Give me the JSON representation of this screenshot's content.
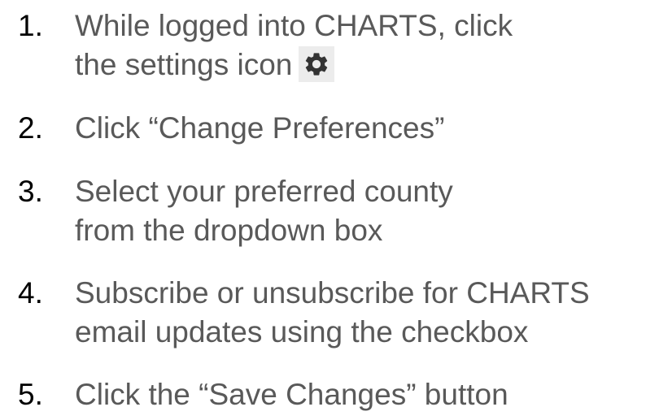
{
  "steps": [
    {
      "number": "1.",
      "lines": [
        "While logged into CHARTS, click",
        "the settings icon"
      ],
      "icon": "gear-icon"
    },
    {
      "number": "2.",
      "lines": [
        "Click “Change Preferences”"
      ]
    },
    {
      "number": "3.",
      "lines": [
        "Select your preferred county",
        "from the dropdown box"
      ]
    },
    {
      "number": "4.",
      "lines": [
        "Subscribe or unsubscribe for CHARTS",
        "email updates using the checkbox"
      ]
    },
    {
      "number": "5.",
      "lines": [
        "Click the “Save Changes” button"
      ]
    }
  ],
  "colors": {
    "number": "#000000",
    "text": "#595959",
    "icon": "#333333",
    "icon_background": "#ececec"
  }
}
